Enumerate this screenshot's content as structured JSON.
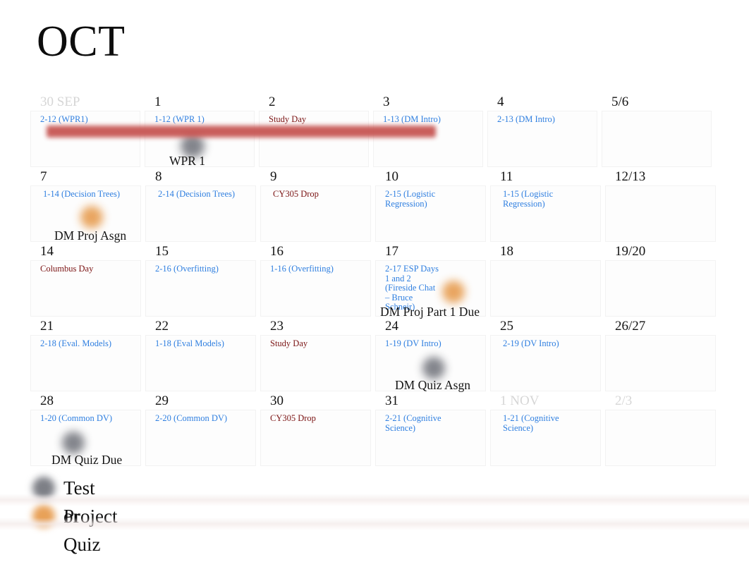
{
  "title": "OCT",
  "colors": {
    "class_event": "#2f7fe0",
    "holiday_event": "#7b1414",
    "span_bar": "#c5514e",
    "quiz_marker": "#7d7f86",
    "project_marker": "#e8a158",
    "muted_day": "#d6d6d6"
  },
  "weeks": [
    {
      "days": [
        {
          "number": "30 SEP",
          "muted": true,
          "events": [
            {
              "text": "2-12 (WPR1)",
              "type": "class"
            }
          ],
          "note": null,
          "marker": null
        },
        {
          "number": "1",
          "muted": false,
          "events": [
            {
              "text": "1-12 (WPR 1)",
              "type": "class"
            }
          ],
          "note": "WPR 1",
          "marker": "quiz"
        },
        {
          "number": "2",
          "muted": false,
          "events": [
            {
              "text": "Study Day",
              "type": "holiday"
            }
          ],
          "note": null,
          "marker": null
        },
        {
          "number": "3",
          "muted": false,
          "events": [
            {
              "text": "1-13 (DM Intro)",
              "type": "class"
            }
          ],
          "note": null,
          "marker": null
        },
        {
          "number": "4",
          "muted": false,
          "events": [
            {
              "text": "2-13 (DM Intro)",
              "type": "class"
            }
          ],
          "note": null,
          "marker": null
        },
        {
          "number": "5/6",
          "muted": false,
          "events": [],
          "note": null,
          "marker": null
        }
      ]
    },
    {
      "days": [
        {
          "number": "7",
          "muted": false,
          "events": [
            {
              "text": "1-14 (Decision Trees)",
              "type": "class"
            }
          ],
          "note": "DM Proj Asgn",
          "marker": "project"
        },
        {
          "number": "8",
          "muted": false,
          "events": [
            {
              "text": "2-14 (Decision Trees)",
              "type": "class"
            }
          ],
          "note": null,
          "marker": null
        },
        {
          "number": "9",
          "muted": false,
          "events": [
            {
              "text": "CY305 Drop",
              "type": "holiday"
            }
          ],
          "note": null,
          "marker": null
        },
        {
          "number": "10",
          "muted": false,
          "events": [
            {
              "text": "2-15 (Logistic Regression)",
              "type": "class"
            }
          ],
          "note": null,
          "marker": null
        },
        {
          "number": "11",
          "muted": false,
          "events": [
            {
              "text": "1-15 (Logistic Regression)",
              "type": "class"
            }
          ],
          "note": null,
          "marker": null
        },
        {
          "number": "12/13",
          "muted": false,
          "events": [],
          "note": null,
          "marker": null
        }
      ]
    },
    {
      "days": [
        {
          "number": "14",
          "muted": false,
          "events": [
            {
              "text": "Columbus Day",
              "type": "holiday"
            }
          ],
          "note": null,
          "marker": null
        },
        {
          "number": "15",
          "muted": false,
          "events": [
            {
              "text": "2-16 (Overfitting)",
              "type": "class"
            }
          ],
          "note": null,
          "marker": null
        },
        {
          "number": "16",
          "muted": false,
          "events": [
            {
              "text": "1-16 (Overfitting)",
              "type": "class"
            }
          ],
          "note": null,
          "marker": null
        },
        {
          "number": "17",
          "muted": false,
          "events": [
            {
              "text": "2-17 ESP Days 1 and 2 (Fireside Chat – Bruce Schneir)",
              "type": "class"
            }
          ],
          "note": "DM Proj Part 1 Due",
          "marker": "project"
        },
        {
          "number": "18",
          "muted": false,
          "events": [],
          "note": null,
          "marker": null
        },
        {
          "number": "19/20",
          "muted": false,
          "events": [],
          "note": null,
          "marker": null
        }
      ]
    },
    {
      "days": [
        {
          "number": "21",
          "muted": false,
          "events": [
            {
              "text": "2-18 (Eval. Models)",
              "type": "class"
            }
          ],
          "note": null,
          "marker": null
        },
        {
          "number": "22",
          "muted": false,
          "events": [
            {
              "text": "1-18 (Eval Models)",
              "type": "class"
            }
          ],
          "note": null,
          "marker": null
        },
        {
          "number": "23",
          "muted": false,
          "events": [
            {
              "text": "Study Day",
              "type": "holiday"
            }
          ],
          "note": null,
          "marker": null
        },
        {
          "number": "24",
          "muted": false,
          "events": [
            {
              "text": "1-19 (DV Intro)",
              "type": "class"
            }
          ],
          "note": "DM Quiz Asgn",
          "marker": "quiz"
        },
        {
          "number": "25",
          "muted": false,
          "events": [
            {
              "text": "2-19 (DV Intro)",
              "type": "class"
            }
          ],
          "note": null,
          "marker": null
        },
        {
          "number": "26/27",
          "muted": false,
          "events": [],
          "note": null,
          "marker": null
        }
      ]
    },
    {
      "days": [
        {
          "number": "28",
          "muted": false,
          "events": [
            {
              "text": "1-20 (Common DV)",
              "type": "class"
            }
          ],
          "note": "DM Quiz Due",
          "marker": "quiz"
        },
        {
          "number": "29",
          "muted": false,
          "events": [
            {
              "text": "2-20 (Common DV)",
              "type": "class"
            }
          ],
          "note": null,
          "marker": null
        },
        {
          "number": "30",
          "muted": false,
          "events": [
            {
              "text": "CY305 Drop",
              "type": "holiday"
            }
          ],
          "note": null,
          "marker": null
        },
        {
          "number": "31",
          "muted": false,
          "events": [
            {
              "text": "2-21 (Cognitive Science)",
              "type": "class"
            }
          ],
          "note": null,
          "marker": null
        },
        {
          "number": "1 NOV",
          "muted": true,
          "events": [
            {
              "text": "1-21 (Cognitive Science)",
              "type": "class"
            }
          ],
          "note": null,
          "marker": null
        },
        {
          "number": "2/3",
          "muted": true,
          "events": [],
          "note": null,
          "marker": null
        }
      ]
    }
  ],
  "legend": [
    {
      "marker": "quiz",
      "label": "Test or Quiz"
    },
    {
      "marker": "project",
      "label": "Project"
    }
  ]
}
